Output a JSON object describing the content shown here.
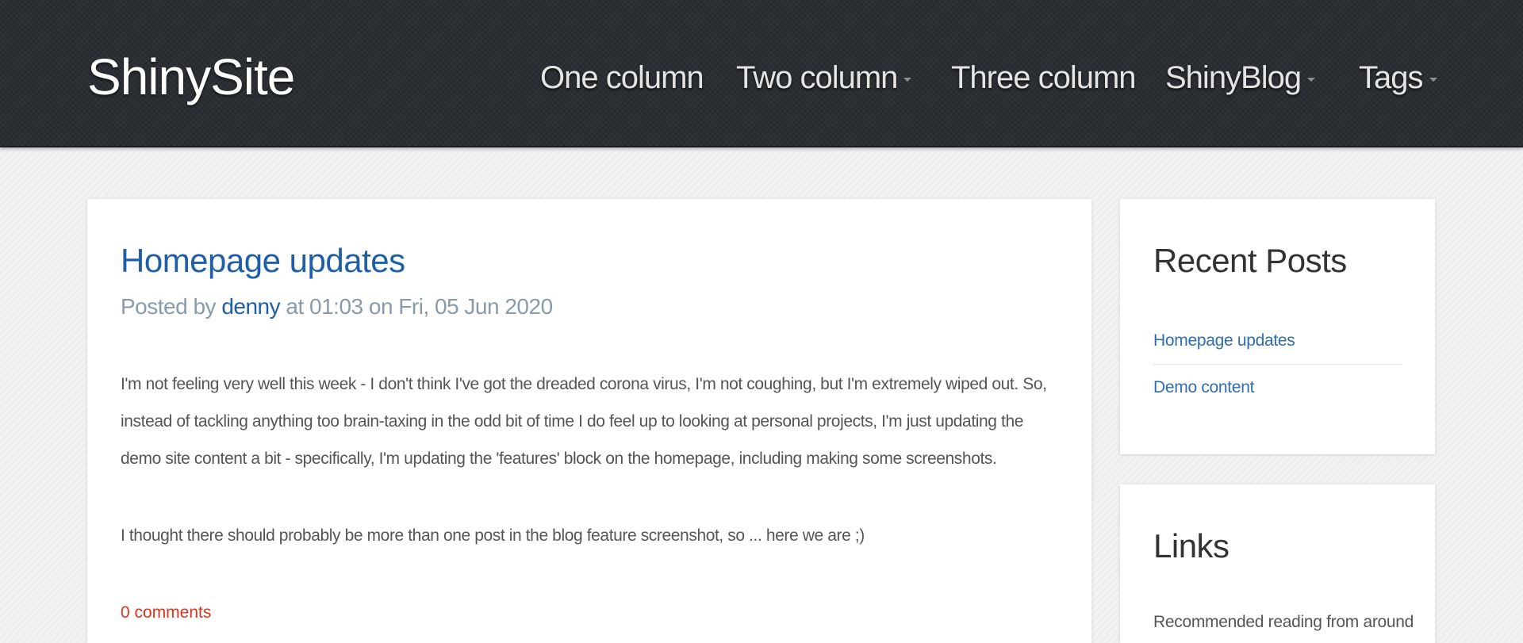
{
  "site": {
    "brand": "ShinySite"
  },
  "nav": {
    "items": [
      {
        "label": "One column",
        "dropdown": false
      },
      {
        "label": "Two column",
        "dropdown": true
      },
      {
        "label": "Three column",
        "dropdown": false
      },
      {
        "label": "ShinyBlog",
        "dropdown": true
      },
      {
        "label": "Tags",
        "dropdown": true
      }
    ]
  },
  "post": {
    "title": "Homepage updates",
    "meta_prefix": "Posted by",
    "author": "denny",
    "meta_suffix": "at 01:03 on Fri, 05 Jun 2020",
    "paragraphs": [
      "I'm not feeling very well this week - I don't think I've got the dreaded corona virus, I'm not coughing, but I'm extremely wiped out. So, instead of tackling anything too brain-taxing in the odd bit of time I do feel up to looking at personal projects, I'm just updating the demo site content a bit - specifically, I'm updating the 'features' block on the homepage, including making some screenshots.",
      "I thought there should probably be more than one post in the blog feature screenshot, so ... here we are ;)"
    ],
    "comments_link": "0 comments"
  },
  "sidebar": {
    "recent_posts": {
      "title": "Recent Posts",
      "items": [
        "Homepage updates",
        "Demo content"
      ]
    },
    "links": {
      "title": "Links",
      "text": "Recommended reading from around"
    }
  },
  "colors": {
    "header_bg": "#2b2f33",
    "link": "#1e5fa8",
    "meta": "#8a9aad",
    "comments": "#e0331b",
    "page_bg": "#eeeeee"
  }
}
